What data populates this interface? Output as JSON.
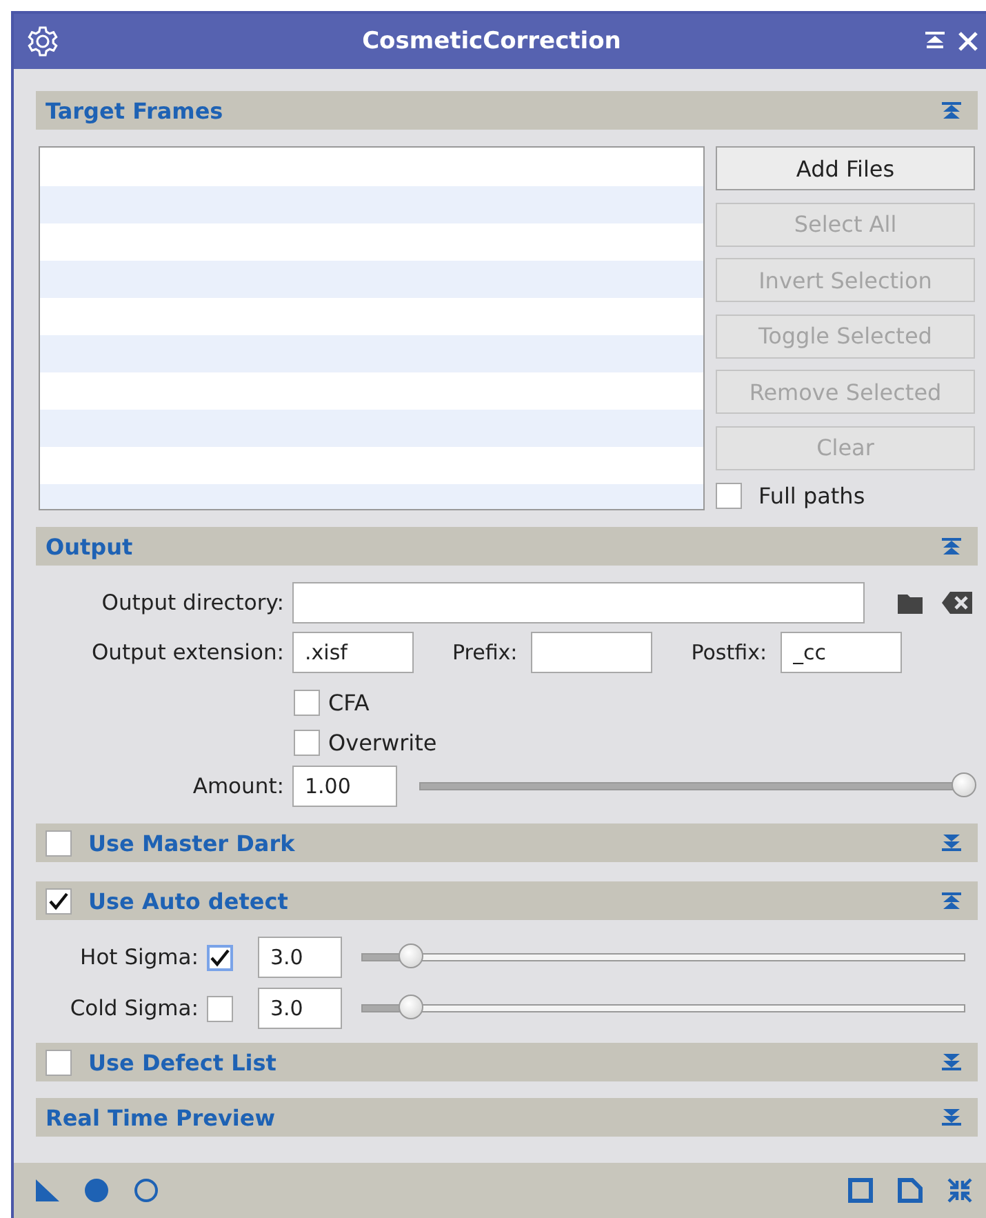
{
  "window": {
    "title": "CosmeticCorrection"
  },
  "target_frames": {
    "title": "Target Frames",
    "expanded": true,
    "buttons": [
      {
        "label": "Add Files",
        "disabled": false
      },
      {
        "label": "Select All",
        "disabled": true
      },
      {
        "label": "Invert Selection",
        "disabled": true
      },
      {
        "label": "Toggle Selected",
        "disabled": true
      },
      {
        "label": "Remove Selected",
        "disabled": true
      },
      {
        "label": "Clear",
        "disabled": true
      }
    ],
    "full_paths": {
      "label": "Full paths",
      "checked": false
    }
  },
  "output": {
    "title": "Output",
    "expanded": true,
    "output_directory": {
      "label": "Output directory:"
    },
    "output_extension": {
      "label": "Output extension:",
      "value": ".xisf"
    },
    "prefix": {
      "label": "Prefix:"
    },
    "postfix": {
      "label": "Postfix:",
      "value": "_cc"
    },
    "options": [
      {
        "label": "CFA",
        "checked": false
      },
      {
        "label": "Overwrite",
        "checked": false
      }
    ],
    "amount": {
      "label": "Amount:",
      "value": "1.00",
      "level": 1
    }
  },
  "master_dark": {
    "title": "Use Master Dark",
    "checked": false,
    "expanded": false
  },
  "auto_detect": {
    "title": "Use Auto detect",
    "checked": true,
    "expanded": true,
    "rows": [
      {
        "label": "Hot Sigma:",
        "checked": true,
        "focused": true,
        "value": "3.0",
        "level": 0.08
      },
      {
        "label": "Cold Sigma:",
        "checked": false,
        "focused": false,
        "value": "3.0",
        "level": 0.08
      }
    ]
  },
  "defect_list": {
    "title": "Use Defect List",
    "checked": false,
    "expanded": false
  },
  "real_time_preview": {
    "title": "Real Time Preview",
    "expanded": false
  }
}
